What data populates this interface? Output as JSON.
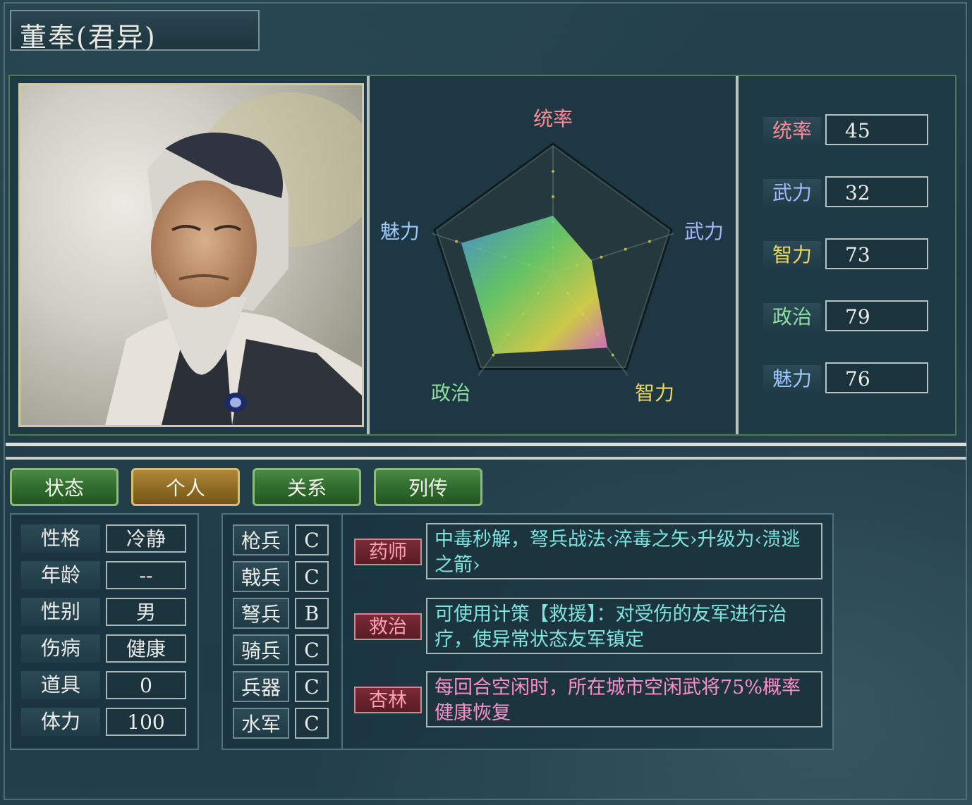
{
  "officer": {
    "name": "董奉(君异)"
  },
  "stats": [
    {
      "label": "统率",
      "value": "45",
      "color": "#ff8a9a"
    },
    {
      "label": "武力",
      "value": "32",
      "color": "#a7b6ff"
    },
    {
      "label": "智力",
      "value": "73",
      "color": "#f1d65f"
    },
    {
      "label": "政治",
      "value": "79",
      "color": "#8fe0a0"
    },
    {
      "label": "魅力",
      "value": "76",
      "color": "#9ec9ff"
    }
  ],
  "radar": {
    "labels": [
      "统率",
      "武力",
      "智力",
      "政治",
      "魅力"
    ],
    "values": [
      45,
      32,
      73,
      79,
      76
    ],
    "max": 100
  },
  "tabs": [
    {
      "label": "状态",
      "active": false
    },
    {
      "label": "个人",
      "active": true
    },
    {
      "label": "关系",
      "active": false
    },
    {
      "label": "列传",
      "active": false
    }
  ],
  "personal": [
    {
      "label": "性格",
      "value": "冷静"
    },
    {
      "label": "年龄",
      "value": "--"
    },
    {
      "label": "性别",
      "value": "男"
    },
    {
      "label": "伤病",
      "value": "健康"
    },
    {
      "label": "道具",
      "value": "0"
    },
    {
      "label": "体力",
      "value": "100"
    }
  ],
  "aptitudes": [
    {
      "label": "枪兵",
      "value": "C"
    },
    {
      "label": "戟兵",
      "value": "C"
    },
    {
      "label": "弩兵",
      "value": "B"
    },
    {
      "label": "骑兵",
      "value": "C"
    },
    {
      "label": "兵器",
      "value": "C"
    },
    {
      "label": "水军",
      "value": "C"
    }
  ],
  "skills": [
    {
      "name": "药师",
      "desc": "中毒秒解，弩兵战法‹淬毒之矢›升级为‹溃逃之箭›",
      "color": "cyan"
    },
    {
      "name": "救治",
      "desc": "可使用计策【救援】：对受伤的友军进行治疗，使异常状态友军镇定",
      "color": "cyan"
    },
    {
      "name": "杏林",
      "desc": "每回合空闲时，所在城市空闲武将75%概率健康恢复",
      "color": "pink"
    }
  ]
}
